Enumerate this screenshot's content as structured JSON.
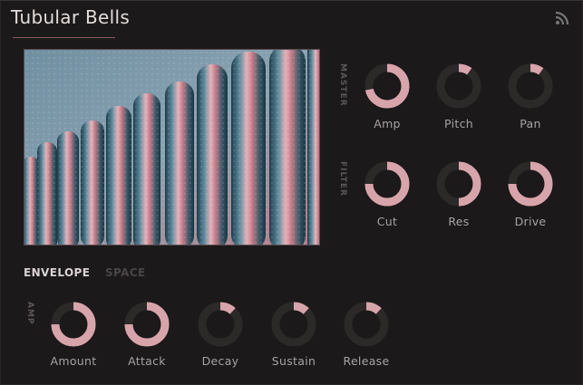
{
  "title": "Tubular Bells",
  "colors": {
    "accent": "#d8a4ab",
    "track": "#2c2929",
    "background": "#1b1919"
  },
  "icons": {
    "feed": "rss-icon"
  },
  "image": {
    "subject": "tubular-bells-photo"
  },
  "master": {
    "label": "MASTER",
    "knobs": [
      {
        "id": "amp",
        "label": "Amp",
        "value": 0.72
      },
      {
        "id": "pitch",
        "label": "Pitch",
        "value": 0.1
      },
      {
        "id": "pan",
        "label": "Pan",
        "value": 0.1
      }
    ]
  },
  "filter": {
    "label": "FILTER",
    "knobs": [
      {
        "id": "cut",
        "label": "Cut",
        "value": 0.75
      },
      {
        "id": "res",
        "label": "Res",
        "value": 0.5
      },
      {
        "id": "drive",
        "label": "Drive",
        "value": 0.75
      }
    ]
  },
  "tabs": {
    "envelope": "ENVELOPE",
    "space": "SPACE"
  },
  "amp": {
    "label": "AMP",
    "knobs": [
      {
        "id": "amount",
        "label": "Amount",
        "value": 0.75
      },
      {
        "id": "attack",
        "label": "Attack",
        "value": 0.75
      },
      {
        "id": "decay",
        "label": "Decay",
        "value": 0.12
      },
      {
        "id": "sustain",
        "label": "Sustain",
        "value": 0.12
      },
      {
        "id": "release",
        "label": "Release",
        "value": 0.12
      }
    ]
  }
}
